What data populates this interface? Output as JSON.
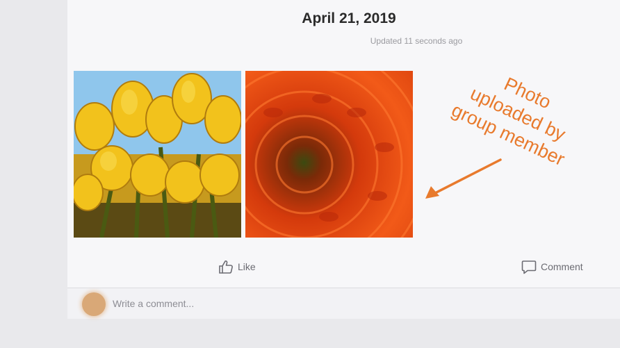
{
  "post": {
    "date": "April 21, 2019",
    "updated": "Updated 11 seconds ago",
    "photos": [
      {
        "description": "Yellow tulips against a blue sky"
      },
      {
        "description": "Orange-red chrysanthemum close-up"
      }
    ],
    "actions": {
      "like_label": "Like",
      "comment_label": "Comment"
    }
  },
  "comment_box": {
    "placeholder": "Write a comment..."
  },
  "annotation": {
    "lines": [
      "Photo",
      "uploaded by",
      "group member"
    ],
    "color": "#e87a2d"
  },
  "icons": {
    "like": "thumbs-up-icon",
    "comment": "speech-bubble-icon"
  }
}
